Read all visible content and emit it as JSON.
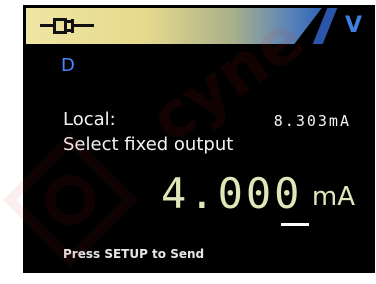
{
  "status_bar": {
    "icon": "plug-icon",
    "units_flag": "V",
    "colors": {
      "left": "#efe6a4",
      "right": "#2f63b8",
      "flag": "#3f7fe0"
    }
  },
  "mode": "D",
  "local": {
    "label": "Local:",
    "value": "8.303mA"
  },
  "prompt": "Select fixed output",
  "output": {
    "value": "4.000",
    "unit": "mA"
  },
  "hint": "Press SETUP to Send",
  "watermark": {
    "text": "cyne",
    "icon": "gear-logo-icon"
  }
}
